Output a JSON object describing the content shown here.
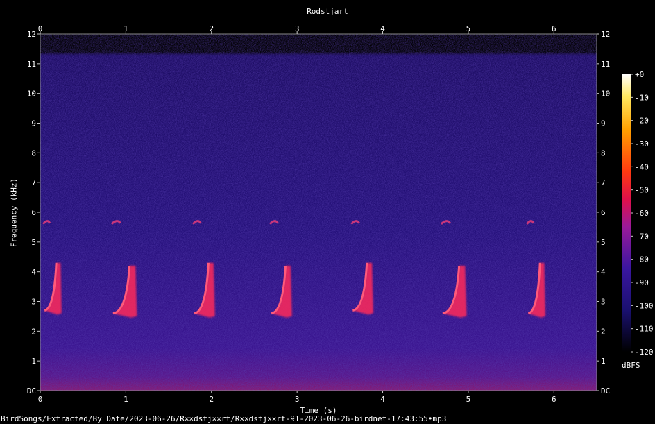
{
  "chart_data": {
    "type": "heatmap",
    "title": "Rodstjart",
    "xlabel": "Time (s)",
    "ylabel": "Frequency (kHz)",
    "xlim": [
      0,
      6.5
    ],
    "ylim": [
      0,
      12
    ],
    "x_ticks": [
      "0",
      "1",
      "2",
      "3",
      "4",
      "5",
      "6"
    ],
    "y_ticks": [
      "DC",
      "1",
      "2",
      "3",
      "4",
      "5",
      "6",
      "7",
      "8",
      "9",
      "10",
      "11",
      "12"
    ],
    "colorbar": {
      "label": "dBFS",
      "range": [
        -120,
        0
      ],
      "ticks": [
        "+0",
        "-10",
        "-20",
        "-30",
        "-40",
        "-50",
        "-60",
        "-70",
        "-80",
        "-90",
        "-100",
        "-110",
        "-120"
      ]
    },
    "calls": [
      {
        "start": 0.05,
        "end": 0.3,
        "low_khz": 2.7,
        "high_khz": 4.3
      },
      {
        "start": 0.85,
        "end": 1.2,
        "low_khz": 2.6,
        "high_khz": 4.2
      },
      {
        "start": 1.8,
        "end": 2.1,
        "low_khz": 2.6,
        "high_khz": 4.3
      },
      {
        "start": 2.7,
        "end": 3.0,
        "low_khz": 2.6,
        "high_khz": 4.2
      },
      {
        "start": 3.65,
        "end": 3.95,
        "low_khz": 2.7,
        "high_khz": 4.3
      },
      {
        "start": 4.7,
        "end": 5.05,
        "low_khz": 2.6,
        "high_khz": 4.2
      },
      {
        "start": 5.7,
        "end": 5.95,
        "low_khz": 2.6,
        "high_khz": 4.3
      }
    ],
    "colors": {
      "background": "#000000",
      "noise": "#1a0a5a",
      "signal": "#ff2a5a"
    }
  },
  "footer": {
    "file_path": "BirdSongs/Extracted/By_Date/2023-06-26/R××dstj××rt/R××dstj××rt-91-2023-06-26-birdnet-17:43:55•mp3"
  }
}
